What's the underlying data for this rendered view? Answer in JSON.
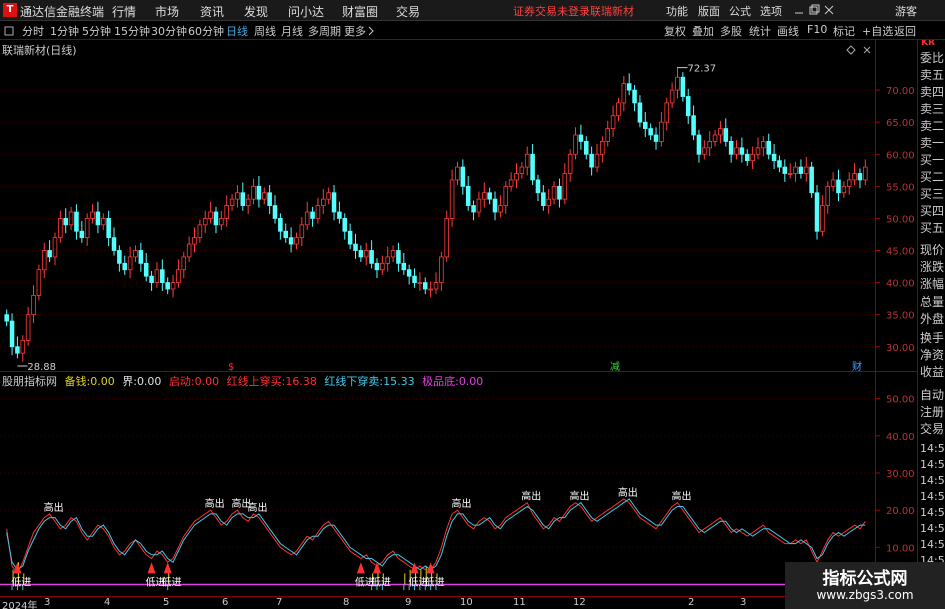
{
  "app": {
    "name": "通达信金融终端",
    "menus": [
      "行情",
      "市场",
      "资讯",
      "发现",
      "问小达",
      "财富圈",
      "交易"
    ],
    "warning": "证券交易未登录",
    "stock_name": "联瑞新材",
    "right_menus": [
      "功能",
      "版面",
      "公式",
      "选项"
    ],
    "guest": "游客"
  },
  "periods": {
    "items": [
      "分时",
      "1分钟",
      "5分钟",
      "15分钟",
      "30分钟",
      "60分钟",
      "日线",
      "周线",
      "月线",
      "多周期",
      "更多"
    ],
    "active": "日线",
    "tools": [
      "复权",
      "叠加",
      "多股",
      "统计",
      "画线",
      "F10",
      "标记",
      "+自选",
      "返回"
    ]
  },
  "main_panel": {
    "title": "联瑞新材(日线)",
    "high_label": "72.37",
    "low_label": "28.88",
    "markers": [
      {
        "text": "$",
        "color": "#ff3030"
      },
      {
        "text": "减",
        "color": "#40d040"
      },
      {
        "text": "财",
        "color": "#40a0ff"
      }
    ]
  },
  "indicator": {
    "name": "股朋指标网",
    "items": [
      {
        "label": "备钱:",
        "value": "0.00",
        "color": "#e0d020"
      },
      {
        "label": "界:",
        "value": "0.00",
        "color": "#e0e0e0"
      },
      {
        "label": "启动:",
        "value": "0.00",
        "color": "#ff3030"
      },
      {
        "label": "红线上穿买:",
        "value": "16.38",
        "color": "#ff3030"
      },
      {
        "label": "红线下穿卖:",
        "value": "15.33",
        "color": "#40c8e8"
      },
      {
        "label": "极品底:",
        "value": "0.00",
        "color": "#e040e0"
      }
    ],
    "text_high": "高出",
    "text_low": "低进"
  },
  "sidebar": {
    "logo": "KR",
    "items": [
      "委比",
      "卖五",
      "卖四",
      "卖三",
      "卖二",
      "卖一",
      "买一",
      "买二",
      "买三",
      "买四",
      "买五",
      "现价",
      "涨跌",
      "涨幅",
      "总量",
      "外盘",
      "换手",
      "净资",
      "收益"
    ],
    "lower_items": [
      "自动",
      "注册",
      "交易"
    ],
    "times": [
      "14:5",
      "14:5",
      "14:5",
      "14:5",
      "14:5",
      "14:5",
      "14:5",
      "14:5"
    ]
  },
  "date_axis": [
    "2024年",
    "3",
    "4",
    "5",
    "6",
    "7",
    "8",
    "9",
    "10",
    "11",
    "12",
    "2",
    "3"
  ],
  "watermark": {
    "line1": "指标公式网",
    "line2": "www.zbgs3.com"
  },
  "chart_data": [
    {
      "type": "candlestick",
      "title": "联瑞新材(日线)",
      "ylim": [
        27,
        75
      ],
      "yticks": [
        "70.00",
        "65.00",
        "60.00",
        "55.00",
        "50.00",
        "45.00",
        "40.00",
        "35.00",
        "30.00"
      ],
      "ytick_values": [
        70,
        65,
        60,
        55,
        50,
        45,
        40,
        35,
        30
      ],
      "close": [
        34,
        30,
        29,
        31,
        35,
        38,
        42,
        45,
        44,
        47,
        50,
        49,
        51,
        48,
        47,
        50,
        51,
        49,
        50,
        47,
        45,
        43,
        42,
        44,
        45,
        43,
        41,
        40,
        42,
        40,
        39,
        40,
        42,
        44,
        46,
        47,
        49,
        50,
        51,
        49,
        50,
        52,
        53,
        54,
        52,
        53,
        55,
        53,
        54,
        52,
        50,
        48,
        47,
        46,
        47,
        49,
        51,
        50,
        52,
        53,
        54,
        51,
        50,
        48,
        46,
        45,
        44,
        45,
        43,
        42,
        43,
        44,
        45,
        43,
        42,
        41,
        40,
        40,
        39,
        39,
        40,
        44,
        50,
        56,
        58,
        55,
        52,
        51,
        53,
        54,
        53,
        51,
        52,
        55,
        56,
        57,
        58,
        60,
        56,
        54,
        52,
        53,
        55,
        53,
        57,
        60,
        63,
        62,
        60,
        58,
        60,
        62,
        64,
        66,
        68,
        71,
        70,
        68,
        65,
        64,
        63,
        62,
        65,
        68,
        70,
        72,
        69,
        66,
        63,
        60,
        61,
        62,
        63,
        64,
        62,
        60,
        61,
        60,
        59,
        60,
        61,
        62,
        60,
        59,
        58,
        57,
        57,
        58,
        57,
        58,
        54,
        48,
        52,
        55,
        56,
        54,
        55,
        56,
        57,
        56,
        58
      ],
      "last_high": "72.37",
      "last_low": "28.88"
    },
    {
      "type": "line",
      "title": "股朋指标网",
      "ylim": [
        -2,
        55
      ],
      "yticks": [
        "50.00",
        "40.00",
        "30.00",
        "20.00",
        "10.00",
        "0.00"
      ],
      "ytick_values": [
        50,
        40,
        30,
        20,
        10,
        0
      ],
      "series": [
        {
          "name": "红线上穿买",
          "values": [
            15,
            5,
            3,
            6,
            10,
            14,
            16,
            18,
            19,
            17,
            15,
            16,
            18,
            17,
            14,
            12,
            14,
            16,
            15,
            13,
            10,
            8,
            9,
            11,
            12,
            10,
            8,
            7,
            9,
            8,
            6,
            7,
            10,
            13,
            15,
            17,
            18,
            19,
            20,
            18,
            16,
            17,
            19,
            20,
            18,
            17,
            19,
            18,
            16,
            14,
            12,
            10,
            9,
            8,
            9,
            11,
            13,
            12,
            14,
            16,
            17,
            15,
            13,
            11,
            9,
            8,
            7,
            8,
            6,
            5,
            6,
            8,
            9,
            7,
            6,
            5,
            4,
            5,
            4,
            4,
            6,
            10,
            15,
            19,
            20,
            18,
            16,
            15,
            17,
            18,
            17,
            15,
            16,
            18,
            19,
            20,
            21,
            22,
            19,
            17,
            15,
            16,
            18,
            17,
            19,
            21,
            22,
            21,
            19,
            17,
            18,
            19,
            20,
            21,
            22,
            23,
            22,
            20,
            18,
            17,
            16,
            15,
            17,
            19,
            21,
            22,
            20,
            18,
            16,
            14,
            15,
            16,
            17,
            18,
            16,
            14,
            15,
            14,
            13,
            14,
            15,
            16,
            14,
            13,
            12,
            11,
            11,
            12,
            11,
            12,
            9,
            6,
            9,
            12,
            14,
            13,
            14,
            15,
            16,
            15,
            17
          ]
        },
        {
          "name": "红线下穿卖",
          "values": [
            14,
            6,
            4,
            5,
            9,
            12,
            15,
            17,
            18,
            18,
            16,
            15,
            17,
            18,
            15,
            13,
            13,
            15,
            16,
            14,
            11,
            9,
            8,
            10,
            12,
            11,
            9,
            8,
            8,
            9,
            7,
            6,
            9,
            12,
            14,
            16,
            17,
            18,
            19,
            19,
            17,
            16,
            18,
            19,
            19,
            18,
            18,
            19,
            17,
            15,
            13,
            11,
            10,
            9,
            8,
            10,
            12,
            13,
            13,
            15,
            16,
            16,
            14,
            12,
            10,
            9,
            8,
            7,
            7,
            6,
            5,
            7,
            8,
            8,
            7,
            6,
            5,
            4,
            5,
            4,
            5,
            8,
            13,
            17,
            19,
            19,
            17,
            16,
            16,
            17,
            18,
            16,
            15,
            17,
            18,
            19,
            20,
            21,
            20,
            18,
            16,
            15,
            17,
            18,
            18,
            20,
            21,
            22,
            20,
            18,
            17,
            18,
            19,
            20,
            21,
            22,
            23,
            21,
            19,
            18,
            17,
            16,
            16,
            18,
            20,
            21,
            21,
            19,
            17,
            15,
            14,
            15,
            16,
            17,
            17,
            15,
            14,
            15,
            14,
            13,
            14,
            15,
            15,
            14,
            13,
            12,
            11,
            11,
            12,
            11,
            10,
            7,
            8,
            11,
            13,
            14,
            13,
            14,
            15,
            16,
            16
          ]
        }
      ]
    }
  ]
}
